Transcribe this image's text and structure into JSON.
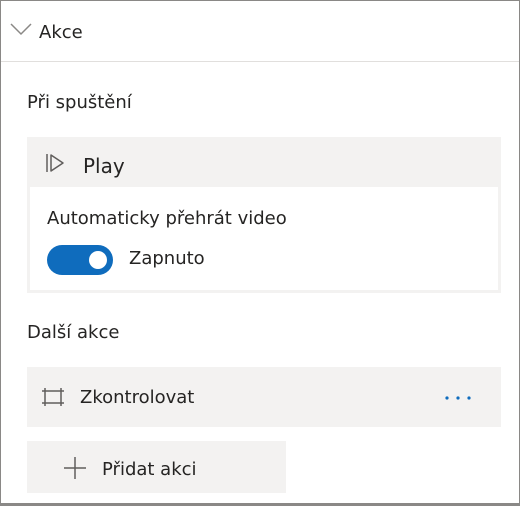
{
  "header": {
    "title": "Akce",
    "toggle_icon": "chevron-down-icon"
  },
  "on_start": {
    "section_title": "Při spuštění",
    "action": {
      "icon": "play-icon",
      "label": "Play"
    },
    "autoplay": {
      "label": "Automaticky přehrát video",
      "state_label": "Zapnuto",
      "enabled": true,
      "accent_color": "#0f6cbd"
    }
  },
  "more_actions": {
    "section_title": "Další akce",
    "items": [
      {
        "icon": "review-frame-icon",
        "label": "Zkontrolovat",
        "menu_icon": "more-horizontal-icon",
        "menu_color": "#0f6cbd"
      }
    ],
    "add_button": {
      "icon": "plus-icon",
      "label": "Přidat akci"
    }
  }
}
